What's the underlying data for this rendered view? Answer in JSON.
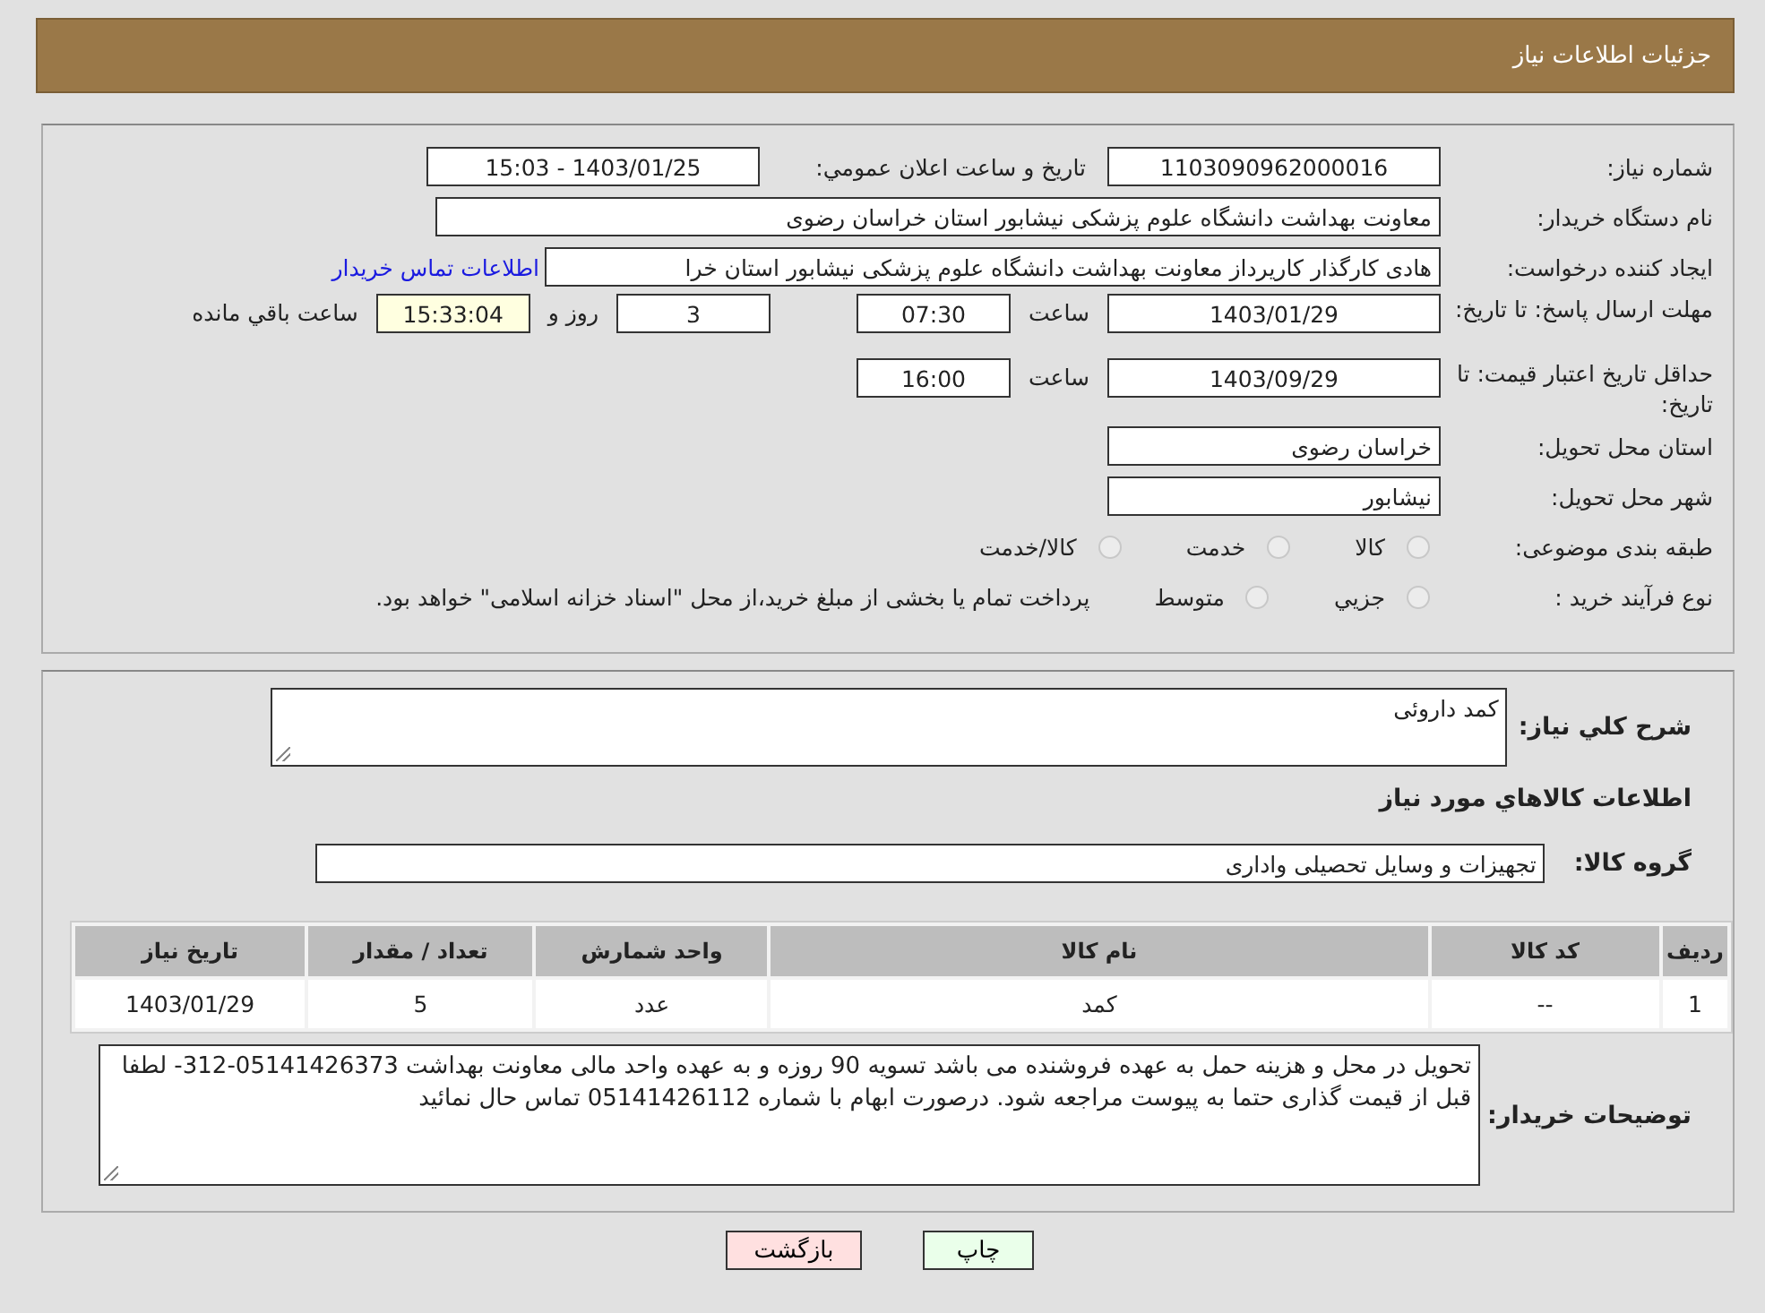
{
  "header": {
    "title": "جزئیات اطلاعات نیاز"
  },
  "need_number": {
    "label": "شماره نیاز:",
    "value": "1103090962000016"
  },
  "announce": {
    "label": "تاریخ و ساعت اعلان عمومي:",
    "value": "1403/01/25 - 15:03"
  },
  "buyer_org": {
    "label": "نام دستگاه خریدار:",
    "value": "معاونت بهداشت دانشگاه علوم پزشکی نیشابور استان خراسان رضوی"
  },
  "creator": {
    "label": "ایجاد کننده درخواست:",
    "value": "هادی کارگذار کاریرداز معاونت بهداشت دانشگاه علوم پزشکی نیشابور استان خرا",
    "link": "اطلاعات تماس خریدار"
  },
  "reply_deadline": {
    "label": "مهلت ارسال پاسخ: تا تاریخ:",
    "date": "1403/01/29",
    "time_label": "ساعت",
    "time": "07:30",
    "days": "3",
    "days_label": "روز و",
    "remaining": "15:33:04",
    "remaining_label": "ساعت باقي مانده"
  },
  "price_validity": {
    "label": "حداقل تاریخ اعتبار قیمت: تا تاریخ:",
    "date": "1403/09/29",
    "time_label": "ساعت",
    "time": "16:00"
  },
  "province": {
    "label": "استان محل تحویل:",
    "value": "خراسان رضوی"
  },
  "city": {
    "label": "شهر محل تحویل:",
    "value": "نیشابور"
  },
  "category": {
    "label": "طبقه بندی موضوعی:",
    "options": [
      {
        "label": "کالا",
        "selected": false
      },
      {
        "label": "خدمت",
        "selected": false
      },
      {
        "label": "کالا/خدمت",
        "selected": false
      }
    ]
  },
  "purchase_type": {
    "label": "نوع فرآیند خرید :",
    "options": [
      {
        "label": "جزيي",
        "selected": false
      },
      {
        "label": "متوسط",
        "selected": false
      }
    ],
    "note": "پرداخت تمام یا بخشی از مبلغ خرید،از محل \"اسناد خزانه اسلامی\" خواهد بود."
  },
  "summary": {
    "label": "شرح کلي نیاز:",
    "value": "کمد داروئی"
  },
  "goods_heading": "اطلاعات کالاهاي مورد نیاز",
  "goods_group": {
    "label": "گروه کالا:",
    "value": "تجهیزات و وسایل تحصیلی واداری"
  },
  "table": {
    "columns": [
      "ردیف",
      "کد کالا",
      "نام کالا",
      "واحد شمارش",
      "تعداد / مقدار",
      "تاریخ نیاز"
    ],
    "rows": [
      [
        "1",
        "--",
        "کمد",
        "عدد",
        "5",
        "1403/01/29"
      ]
    ]
  },
  "buyer_notes": {
    "label": "توضیحات خریدار:",
    "value": "تحویل در محل و هزینه حمل به عهده فروشنده می باشد تسویه 90 روزه و به عهده واحد مالی معاونت بهداشت 05141426373-312- لطفا قبل از قیمت گذاری حتما به پیوست مراجعه شود. درصورت ابهام با شماره 05141426112 تماس حال نمائید"
  },
  "buttons": [
    "چاپ",
    "بازگشت"
  ]
}
